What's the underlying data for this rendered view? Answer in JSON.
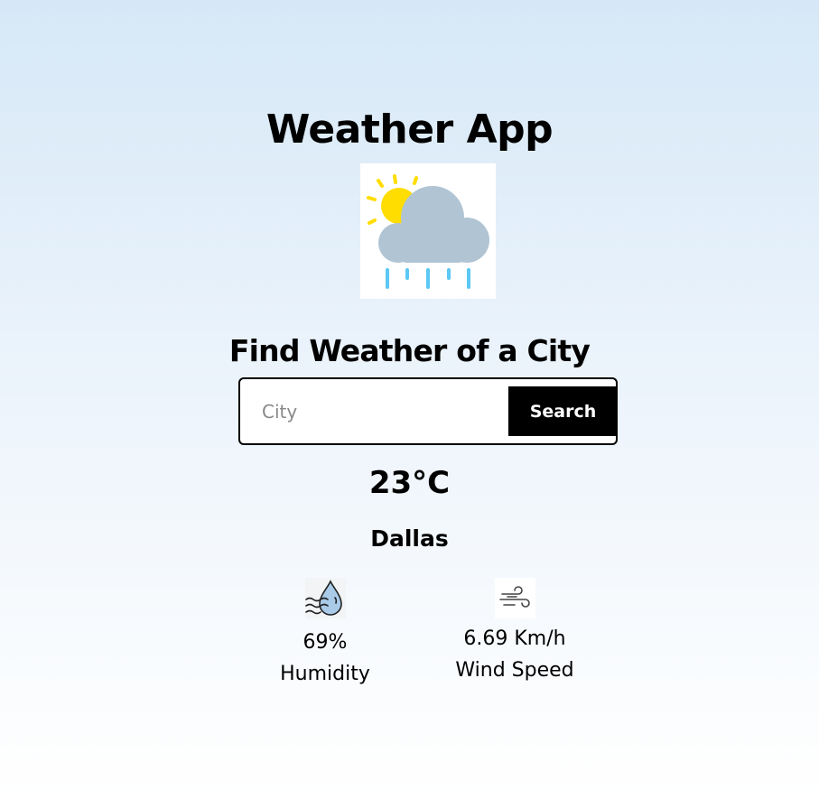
{
  "app": {
    "title": "Weather App",
    "weather_icon": "sun-cloud-rain-icon"
  },
  "search": {
    "heading": "Find Weather of a City",
    "placeholder": "City",
    "value": "",
    "button_label": "Search"
  },
  "weather": {
    "temperature": "23°C",
    "city": "Dallas",
    "humidity": {
      "icon": "humidity-icon",
      "value": "69%",
      "label": "Humidity"
    },
    "wind": {
      "icon": "wind-icon",
      "value": "6.69 Km/h",
      "label": "Wind Speed"
    }
  },
  "colors": {
    "background_top": "#d6e8f7",
    "background_bottom": "#ffffff",
    "button_bg": "#000000",
    "button_text": "#ffffff",
    "sun": "#ffdd00",
    "cloud": "#b0c4d3",
    "rain": "#5bc8f5"
  }
}
